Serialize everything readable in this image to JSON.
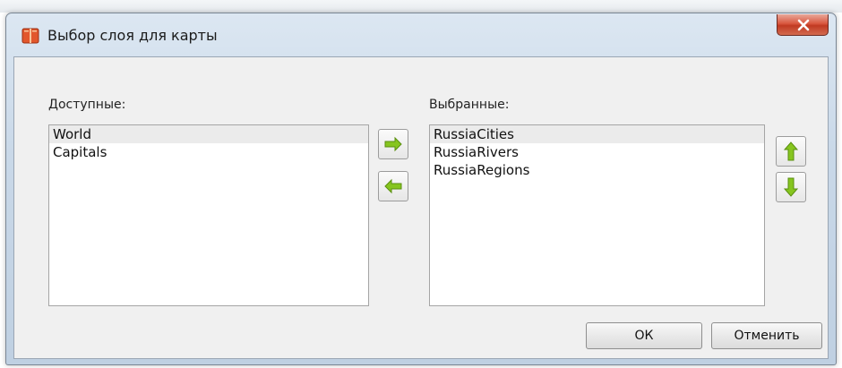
{
  "window": {
    "title": "Выбор слоя для карты",
    "close_label": "x"
  },
  "available": {
    "label": "Доступные:",
    "items": [
      "World",
      "Capitals"
    ]
  },
  "selected": {
    "label": "Выбранные:",
    "items": [
      "RussiaCities",
      "RussiaRivers",
      "RussiaRegions"
    ]
  },
  "buttons": {
    "ok": "ОК",
    "cancel": "Отменить"
  },
  "icons": {
    "add": "arrow-right-icon",
    "remove": "arrow-left-icon",
    "up": "arrow-up-icon",
    "down": "arrow-down-icon",
    "app": "map-book-icon"
  },
  "colors": {
    "arrow_green": "#7fc31c",
    "close_red": "#c9472d",
    "selection": "#ebebeb"
  }
}
